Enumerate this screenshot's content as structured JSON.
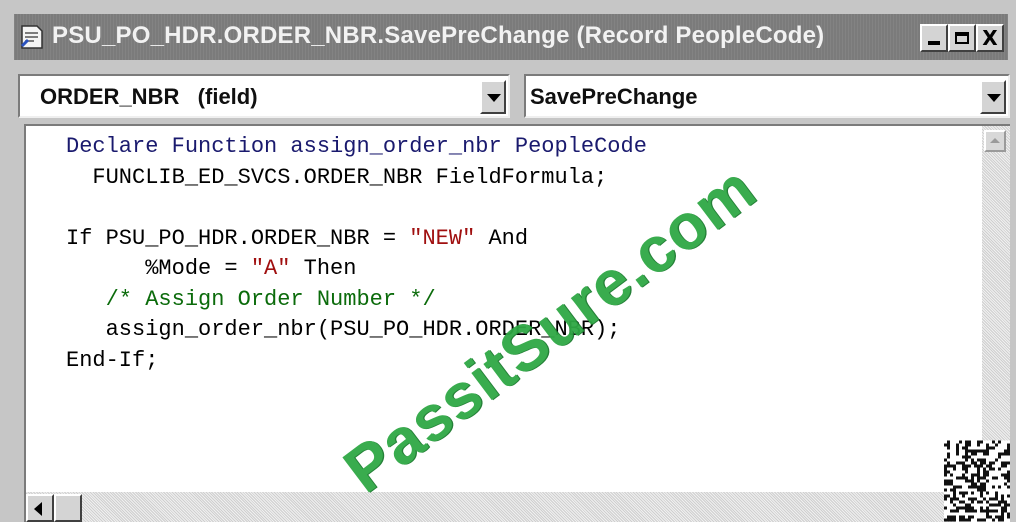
{
  "window": {
    "title": "PSU_PO_HDR.ORDER_NBR.SavePreChange (Record PeopleCode)",
    "icon": "document-icon",
    "controls": {
      "minimize": "minimize-icon",
      "maximize": "maximize-icon",
      "close": "X"
    }
  },
  "object_combo": {
    "value": "ORDER_NBR   (field)"
  },
  "event_combo": {
    "value": "SavePreChange"
  },
  "editor": {
    "lines": [
      [
        {
          "t": "Declare Function assign_order_nbr PeopleCode",
          "c": "kw"
        }
      ],
      [
        {
          "t": "  FUNCLIB_ED_SVCS.ORDER_NBR FieldFormula;",
          "c": ""
        }
      ],
      [
        {
          "t": "",
          "c": ""
        }
      ],
      [
        {
          "t": "If PSU_PO_HDR.ORDER_NBR = ",
          "c": ""
        },
        {
          "t": "\"NEW\"",
          "c": "str"
        },
        {
          "t": " And",
          "c": ""
        }
      ],
      [
        {
          "t": "      %Mode = ",
          "c": ""
        },
        {
          "t": "\"A\"",
          "c": "str"
        },
        {
          "t": " Then",
          "c": ""
        }
      ],
      [
        {
          "t": "   /* Assign Order Number */",
          "c": "cmt"
        }
      ],
      [
        {
          "t": "   assign_order_nbr(PSU_PO_HDR.ORDER_NBR);",
          "c": ""
        }
      ],
      [
        {
          "t": "End-If;",
          "c": ""
        }
      ]
    ]
  },
  "watermark": {
    "text": "PassitSure.com",
    "color": "#2fa845"
  },
  "colors": {
    "titlebar": "#7b7b7b",
    "string": "#a01010",
    "comment": "#0b6b0b",
    "keyword": "#1a1a6e"
  }
}
